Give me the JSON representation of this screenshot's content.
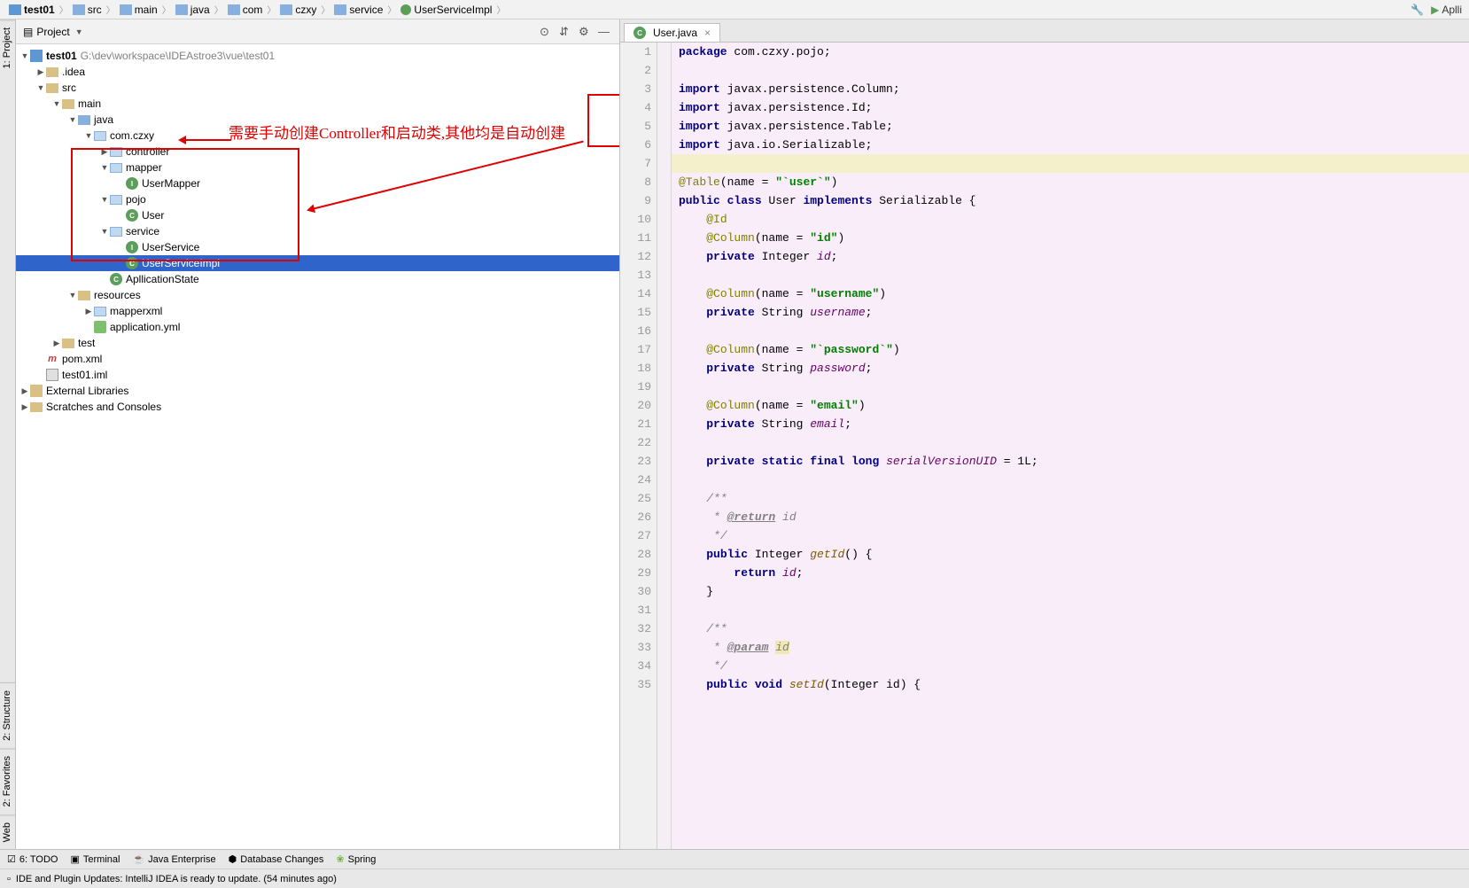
{
  "breadcrumb": [
    "test01",
    "src",
    "main",
    "java",
    "com",
    "czxy",
    "service",
    "UserServiceImpl"
  ],
  "breadcrumb_right": "Aplli",
  "panel": {
    "title": "Project"
  },
  "sidebar": {
    "project": "1: Project",
    "structure": "2: Structure",
    "favorites": "2: Favorites",
    "web": "Web"
  },
  "tree": {
    "root": "test01",
    "root_path": "G:\\dev\\workspace\\IDEAstroe3\\vue\\test01",
    "idea": ".idea",
    "src": "src",
    "main": "main",
    "java": "java",
    "pkg": "com.czxy",
    "controller": "controller",
    "mapper": "mapper",
    "usermapper": "UserMapper",
    "pojo": "pojo",
    "user": "User",
    "service": "service",
    "userservice": "UserService",
    "userserviceimpl": "UserServiceImpl",
    "appstate": "ApllicationState",
    "resources": "resources",
    "mapperxml": "mapperxml",
    "appyml": "application.yml",
    "test": "test",
    "pom": "pom.xml",
    "iml": "test01.iml",
    "extlib": "External Libraries",
    "scratches": "Scratches and Consoles"
  },
  "annotation": "需要手动创建Controller和启动类,其他均是自动创建",
  "editor_tab": "User.java",
  "code_lines": [
    {
      "n": 1,
      "html": "<span class='kw'>package</span> com.czxy.pojo;"
    },
    {
      "n": 2,
      "html": ""
    },
    {
      "n": 3,
      "html": "<span class='kw'>import</span> javax.persistence.Column;"
    },
    {
      "n": 4,
      "html": "<span class='kw'>import</span> javax.persistence.Id;"
    },
    {
      "n": 5,
      "html": "<span class='kw'>import</span> javax.persistence.Table;"
    },
    {
      "n": 6,
      "html": "<span class='kw'>import</span> java.io.Serializable;"
    },
    {
      "n": 7,
      "html": "",
      "cls": "hl-line"
    },
    {
      "n": 8,
      "html": "<span class='ann'>@Table</span>(name = <span class='str'>\"`user`\"</span>)"
    },
    {
      "n": 9,
      "html": "<span class='kw'>public class</span> User <span class='kw'>implements</span> Serializable {"
    },
    {
      "n": 10,
      "html": "    <span class='ann'>@Id</span>"
    },
    {
      "n": 11,
      "html": "    <span class='ann'>@Column</span>(name = <span class='str'>\"id\"</span>)"
    },
    {
      "n": 12,
      "html": "    <span class='kw'>private</span> Integer <span class='fld'>id</span>;"
    },
    {
      "n": 13,
      "html": ""
    },
    {
      "n": 14,
      "html": "    <span class='ann'>@Column</span>(name = <span class='str'>\"username\"</span>)"
    },
    {
      "n": 15,
      "html": "    <span class='kw'>private</span> String <span class='fld'>username</span>;"
    },
    {
      "n": 16,
      "html": ""
    },
    {
      "n": 17,
      "html": "    <span class='ann'>@Column</span>(name = <span class='str'>\"`password`\"</span>)"
    },
    {
      "n": 18,
      "html": "    <span class='kw'>private</span> String <span class='fld'>password</span>;"
    },
    {
      "n": 19,
      "html": ""
    },
    {
      "n": 20,
      "html": "    <span class='ann'>@Column</span>(name = <span class='str'>\"email\"</span>)"
    },
    {
      "n": 21,
      "html": "    <span class='kw'>private</span> String <span class='fld'>email</span>;"
    },
    {
      "n": 22,
      "html": ""
    },
    {
      "n": 23,
      "html": "    <span class='kw'>private static final long</span> <span class='fld'>serialVersionUID</span> = 1L;"
    },
    {
      "n": 24,
      "html": ""
    },
    {
      "n": 25,
      "html": "    <span class='com'>/**</span>"
    },
    {
      "n": 26,
      "html": "    <span class='com'> * <span class='tag'>@return</span> id</span>"
    },
    {
      "n": 27,
      "html": "    <span class='com'> */</span>"
    },
    {
      "n": 28,
      "html": "    <span class='kw'>public</span> Integer <span class='mtd'>getId</span>() {"
    },
    {
      "n": 29,
      "html": "        <span class='kw'>return</span> <span class='fld'>id</span>;"
    },
    {
      "n": 30,
      "html": "    }"
    },
    {
      "n": 31,
      "html": ""
    },
    {
      "n": 32,
      "html": "    <span class='com'>/**</span>"
    },
    {
      "n": 33,
      "html": "    <span class='com'> * <span class='tag'>@param</span> <span class='hl-param'>id</span></span>"
    },
    {
      "n": 34,
      "html": "    <span class='com'> */</span>"
    },
    {
      "n": 35,
      "html": "    <span class='kw'>public void</span> <span class='mtd'>setId</span>(Integer id) {"
    }
  ],
  "bottom": {
    "todo": "6: TODO",
    "terminal": "Terminal",
    "javaee": "Java Enterprise",
    "dbchanges": "Database Changes",
    "spring": "Spring"
  },
  "status": "IDE and Plugin Updates: IntelliJ IDEA is ready to update. (54 minutes ago)"
}
